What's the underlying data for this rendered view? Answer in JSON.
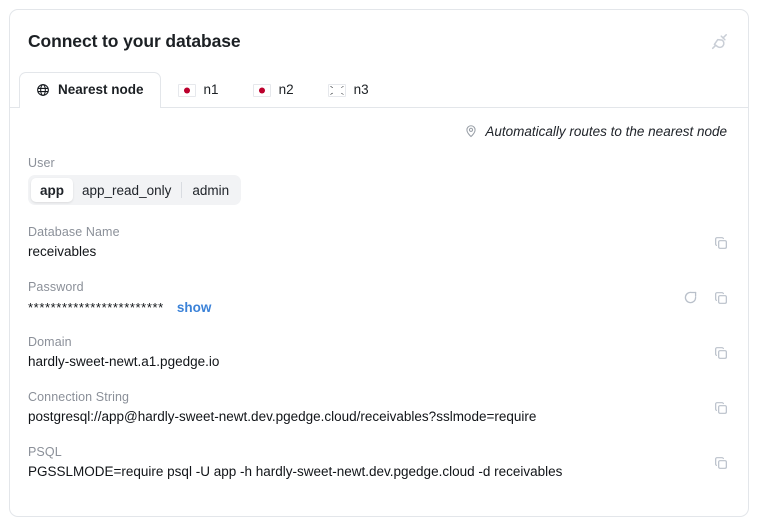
{
  "card": {
    "title": "Connect to your database",
    "plug_icon": "plug-icon"
  },
  "tabs": [
    {
      "label": "Nearest node",
      "icon": "globe-icon",
      "active": true
    },
    {
      "label": "n1",
      "icon": "flag-japan-icon",
      "active": false
    },
    {
      "label": "n2",
      "icon": "flag-japan-icon",
      "active": false
    },
    {
      "label": "n3",
      "icon": "flag-south-korea-icon",
      "active": false
    }
  ],
  "routing": {
    "icon": "map-pin-icon",
    "text": "Automatically routes to the nearest node"
  },
  "user_field": {
    "label": "User",
    "options": [
      "app",
      "app_read_only",
      "admin"
    ],
    "selected": "app"
  },
  "fields": [
    {
      "label": "Database Name",
      "value": "receivables",
      "masked": false,
      "has_copy": true,
      "has_regenerate": false
    },
    {
      "label": "Password",
      "value": "************************",
      "masked": true,
      "toggle_label": "show",
      "has_copy": true,
      "has_regenerate": true
    },
    {
      "label": "Domain",
      "value": "hardly-sweet-newt.a1.pgedge.io",
      "masked": false,
      "has_copy": true,
      "has_regenerate": false
    },
    {
      "label": "Connection String",
      "value": "postgresql://app@hardly-sweet-newt.dev.pgedge.cloud/receivables?sslmode=require",
      "masked": false,
      "has_copy": true,
      "has_regenerate": false
    },
    {
      "label": "PSQL",
      "value": "PGSSLMODE=require psql -U app -h hardly-sweet-newt.dev.pgedge.cloud -d receivables",
      "masked": false,
      "has_copy": true,
      "has_regenerate": false
    }
  ],
  "colors": {
    "link": "#3b82d8",
    "label": "#8b9099",
    "text": "#111418",
    "border": "#e3e6ea",
    "track": "#f2f3f5"
  }
}
